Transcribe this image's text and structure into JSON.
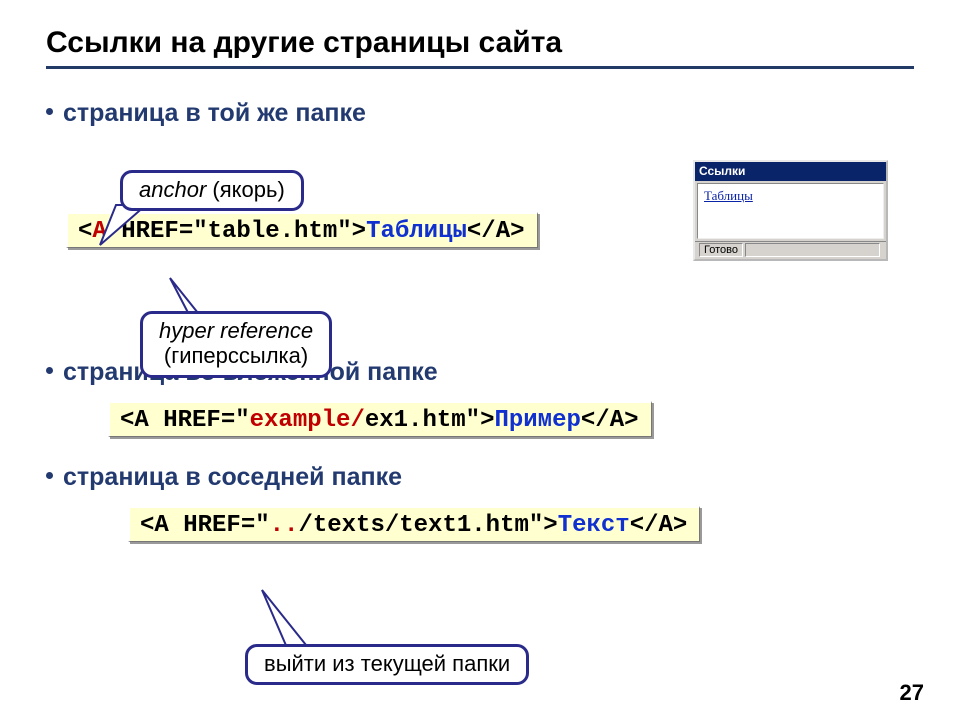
{
  "title": "Ссылки на другие страницы сайта",
  "bullets": {
    "b1": "страница в той же папке",
    "b2": "страница во вложенной папке",
    "b3": "страница в соседней папке"
  },
  "code1": {
    "pre": "<",
    "tagA": "A",
    "mid": " HREF=\"table.htm\">",
    "link": "Таблицы",
    "post": "</A>"
  },
  "code2": {
    "pre": "<A HREF=\"",
    "folder": "example/",
    "file": "ex1.htm\">",
    "link": "Пример",
    "post": "</A>"
  },
  "code3": {
    "pre": "<A HREF=\"",
    "dots": "..",
    "path": "/texts/text1.htm\">",
    "link": "Текст",
    "post": "</A>"
  },
  "callouts": {
    "anchor_it": "anchor",
    "anchor_paren": " (якорь)",
    "href_line1_it": "hyper reference",
    "href_line2": "(гиперссылка)",
    "updir": "выйти из текущей папки"
  },
  "browser": {
    "title": "Ссылки",
    "link": "Таблицы",
    "status": "Готово"
  },
  "pagenum": "27"
}
